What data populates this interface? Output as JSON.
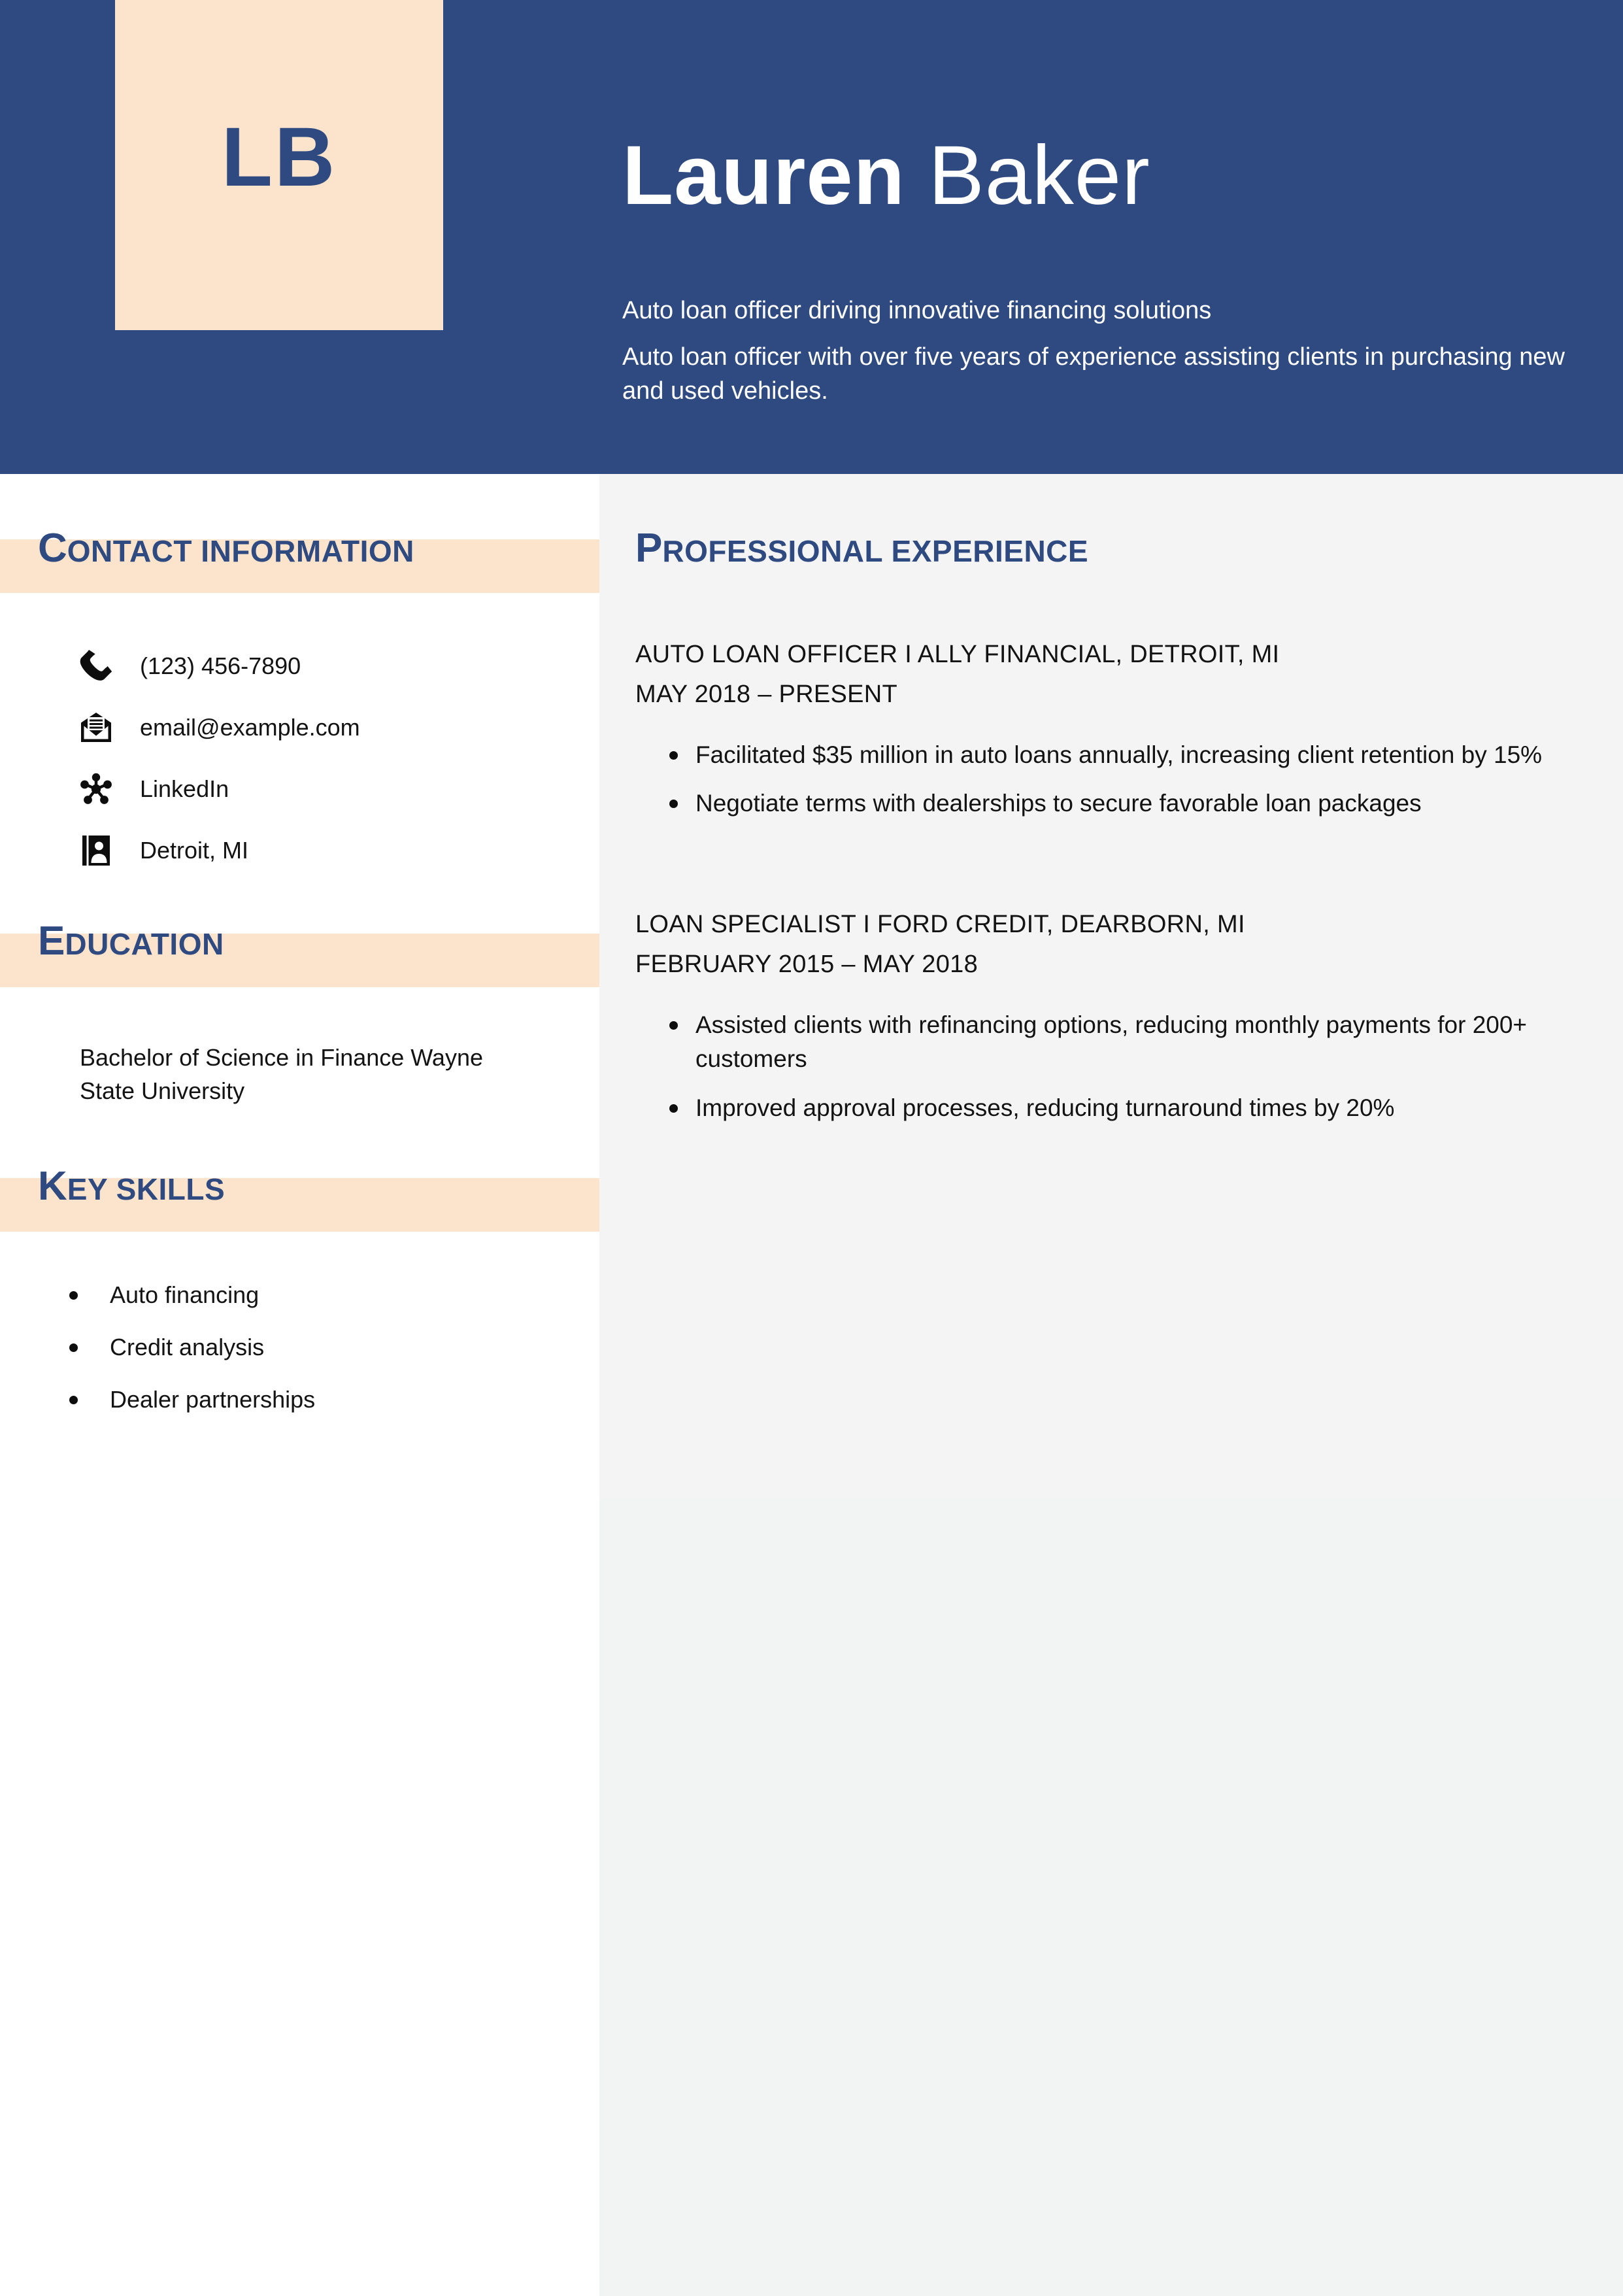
{
  "colors": {
    "header_blue": "#2e4a80",
    "accent_beige": "#fce3cc",
    "panel_gray": "#f4f4f4",
    "body_text": "#131313"
  },
  "header": {
    "logo_initials": "LB",
    "first_name": "Lauren",
    "last_name": "Baker",
    "tagline": "Auto loan officer driving innovative financing solutions",
    "summary": "Auto loan officer with over five years of experience assisting clients in purchasing new and used vehicles."
  },
  "sidebar": {
    "contact": {
      "heading_cap": "C",
      "heading_rest": "ONTACT INFORMATION",
      "items": [
        {
          "icon": "phone-icon",
          "value": "(123) 456-7890"
        },
        {
          "icon": "email-icon",
          "value": "email@example.com"
        },
        {
          "icon": "linkedin-network-icon",
          "value": "LinkedIn"
        },
        {
          "icon": "location-badge-icon",
          "value": "Detroit, MI"
        }
      ]
    },
    "education": {
      "heading_cap": "E",
      "heading_rest": "DUCATION",
      "entry": "Bachelor of Science in Finance Wayne State University"
    },
    "key_skills": {
      "heading_cap": "K",
      "heading_rest": "EY SKILLS",
      "items": [
        "Auto financing",
        "Credit analysis",
        "Dealer partnerships"
      ]
    }
  },
  "main": {
    "experience": {
      "heading_cap": "P",
      "heading_rest": "ROFESSIONAL EXPERIENCE",
      "jobs": [
        {
          "title": "AUTO LOAN OFFICER I ALLY FINANCIAL, DETROIT, MI",
          "dates": "MAY 2018 – PRESENT",
          "bullets": [
            "Facilitated $35 million in auto loans annually, increasing client retention by 15%",
            "Negotiate terms with dealerships to secure favorable loan packages"
          ]
        },
        {
          "title": "LOAN SPECIALIST I FORD CREDIT, DEARBORN, MI",
          "dates": "FEBRUARY 2015 – MAY 2018",
          "bullets": [
            "Assisted clients with refinancing options, reducing monthly payments for 200+ customers",
            "Improved approval processes, reducing turnaround times by 20%"
          ]
        }
      ]
    }
  }
}
